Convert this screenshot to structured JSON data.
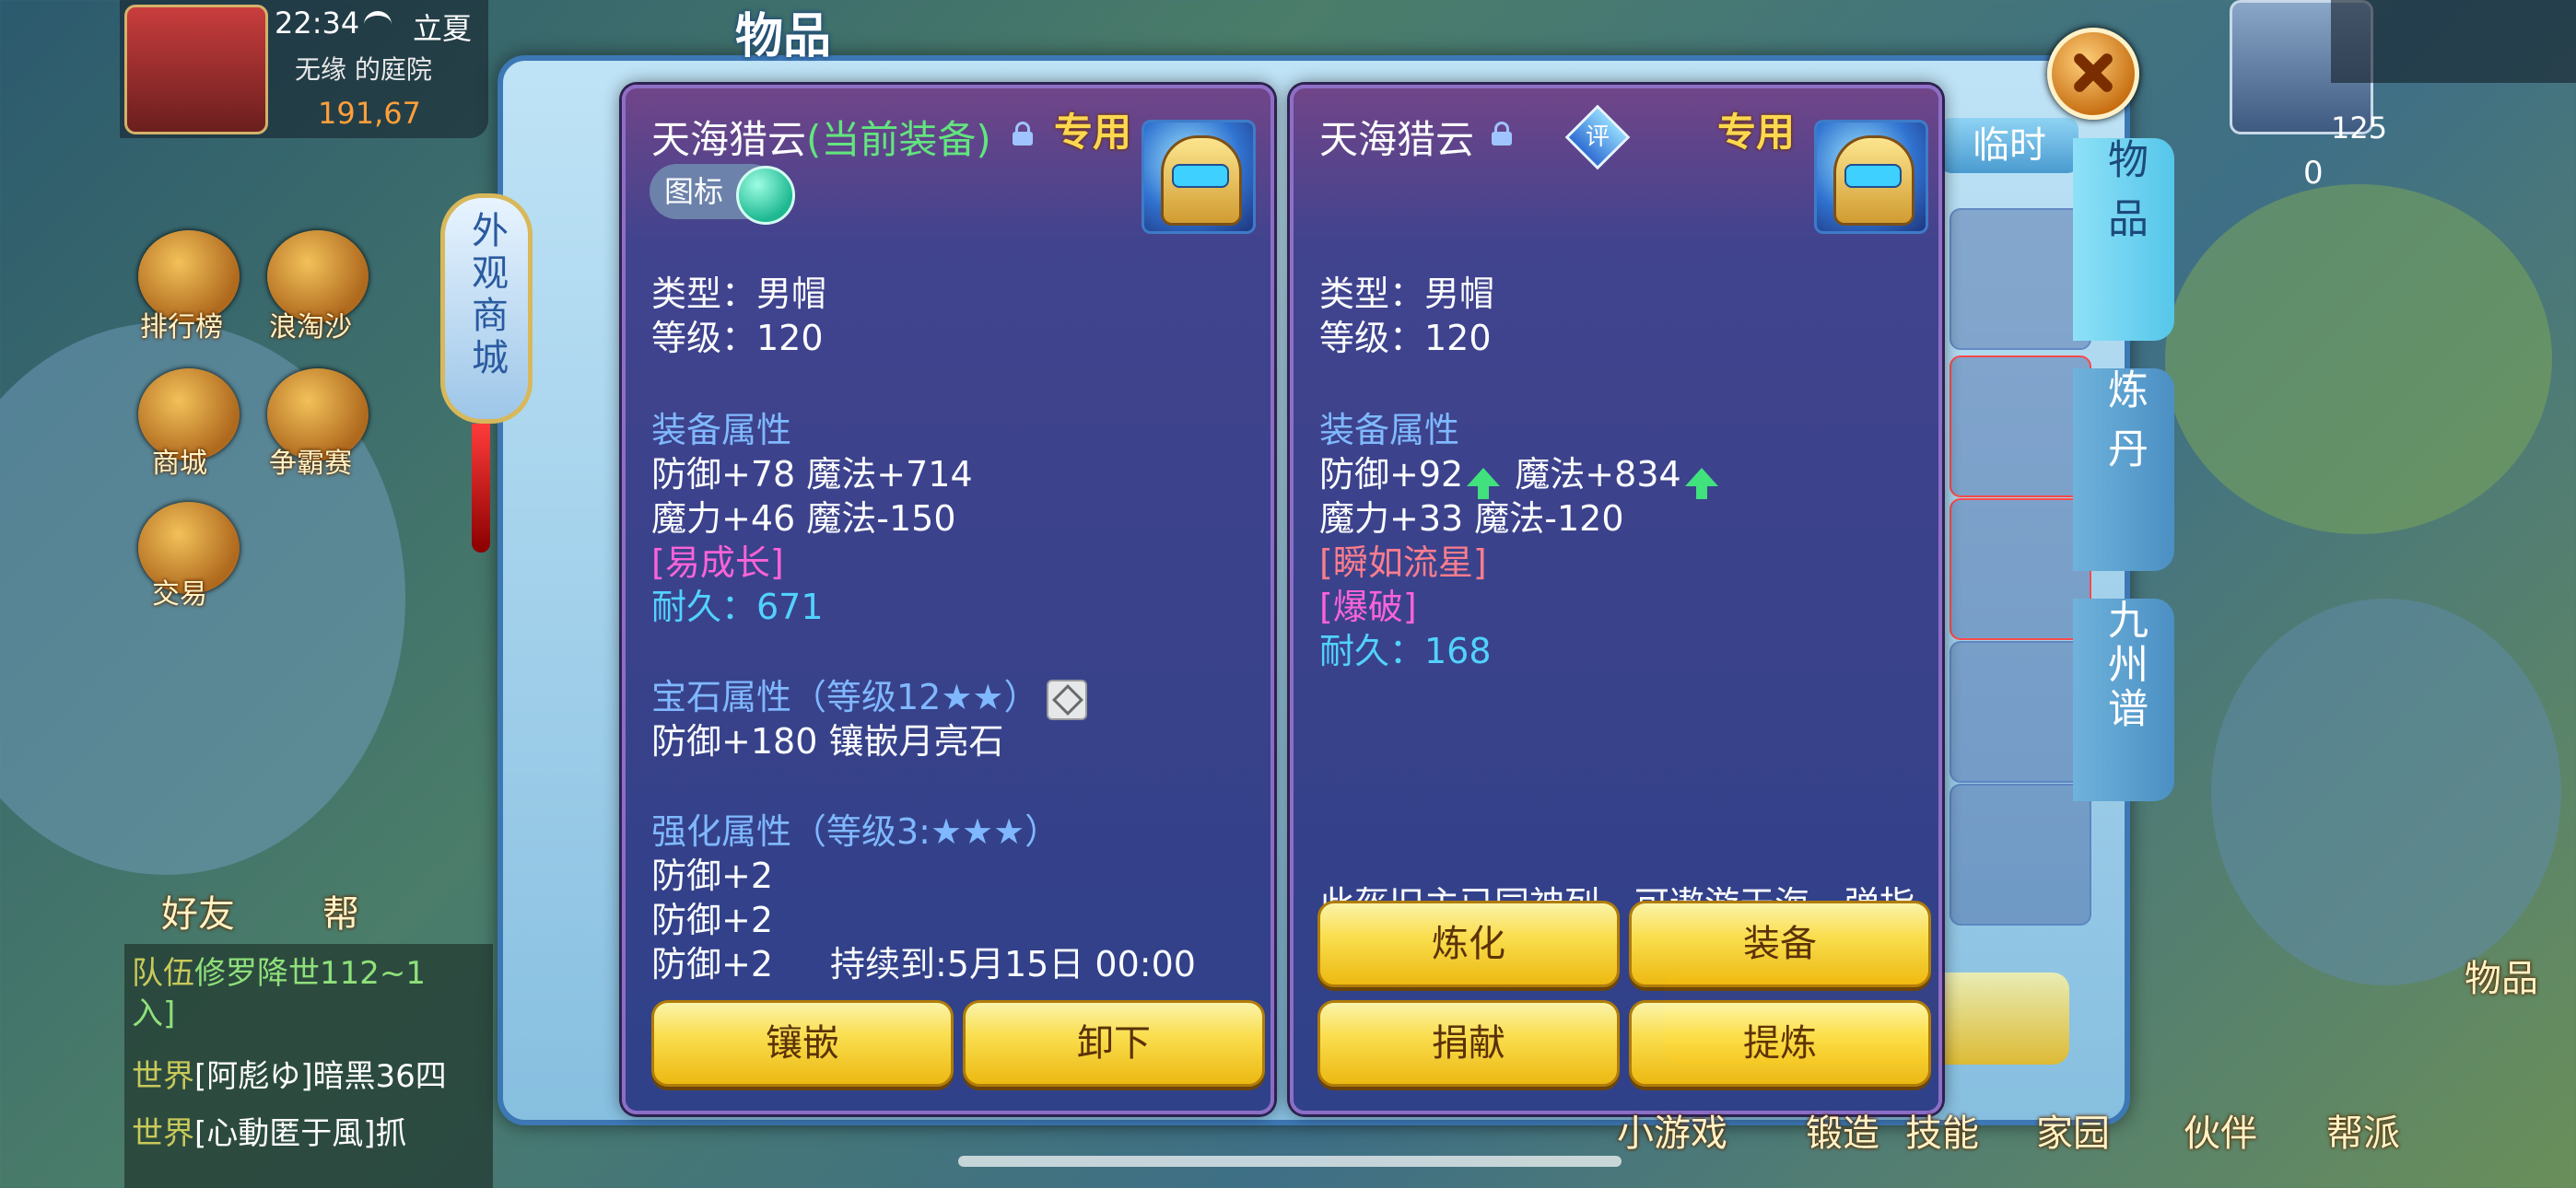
{
  "status_bar": {
    "time": "22:34",
    "location": "立夏",
    "place": "无缘 的庭院",
    "coords": "191,67"
  },
  "hud_right": {
    "level": "125",
    "count": "0"
  },
  "window": {
    "title": "物品",
    "temp_tab": "临时"
  },
  "mall": {
    "label": "外观商城"
  },
  "left_menu": [
    "排行榜",
    "浪淘沙",
    "商城",
    "争霸赛",
    "交易"
  ],
  "side_tabs": [
    "物品",
    "炼丹",
    "九州谱"
  ],
  "equipped_item": {
    "name": "天海猎云",
    "equipped_suffix": "(当前装备)",
    "special": "专用",
    "tag_label": "图标",
    "type": "类型：男帽",
    "level": "等级：120",
    "attr_header": "装备属性",
    "attr_line1": "防御+78 魔法+714",
    "attr_line2": "魔力+46 魔法-150",
    "skill": "[易成长]",
    "durability": "耐久：671",
    "gem_header": "宝石属性（等级12★★）",
    "gem_line": "防御+180 镶嵌月亮石",
    "enh_header": "强化属性（等级3:★★★）",
    "enh_lines": [
      "防御+2",
      "防御+2",
      "防御+2"
    ],
    "duration": "持续到:5月15日 00:00",
    "buttons": [
      "镶嵌",
      "卸下"
    ]
  },
  "compare_item": {
    "name": "天海猎云",
    "rate_badge": "评",
    "special": "专用",
    "type": "类型：男帽",
    "level": "等级：120",
    "attr_header": "装备属性",
    "attr_line1_a": "防御+92",
    "attr_line1_b": "魔法+834",
    "attr_line2": "魔力+33 魔法-120",
    "skill1": "[瞬如流星]",
    "skill2": "[爆破]",
    "durability": "耐久：168",
    "description": "此盔旧主已同神列，可遨游天海，弹指猎云，傲视古今",
    "buttons": [
      "炼化",
      "装备",
      "捐献",
      "提炼"
    ]
  },
  "chat": [
    {
      "channel": "队伍",
      "text": "修罗降世112~1",
      "cont": "入]"
    },
    {
      "channel": "世界",
      "text": "[阿彪ゆ]暗黑36四"
    },
    {
      "channel": "世界",
      "text": "[心動匿于風]抓"
    }
  ],
  "bottom_menu": [
    "好友",
    "帮",
    "小游戏",
    "锻造",
    "技能",
    "家园",
    "伙伴",
    "帮派",
    "物品"
  ],
  "colors": {
    "accent_gold": "#ffd84a",
    "attr_header": "#7fb8ff",
    "equipped": "#5fe67a",
    "durability": "#4fd3ff"
  }
}
